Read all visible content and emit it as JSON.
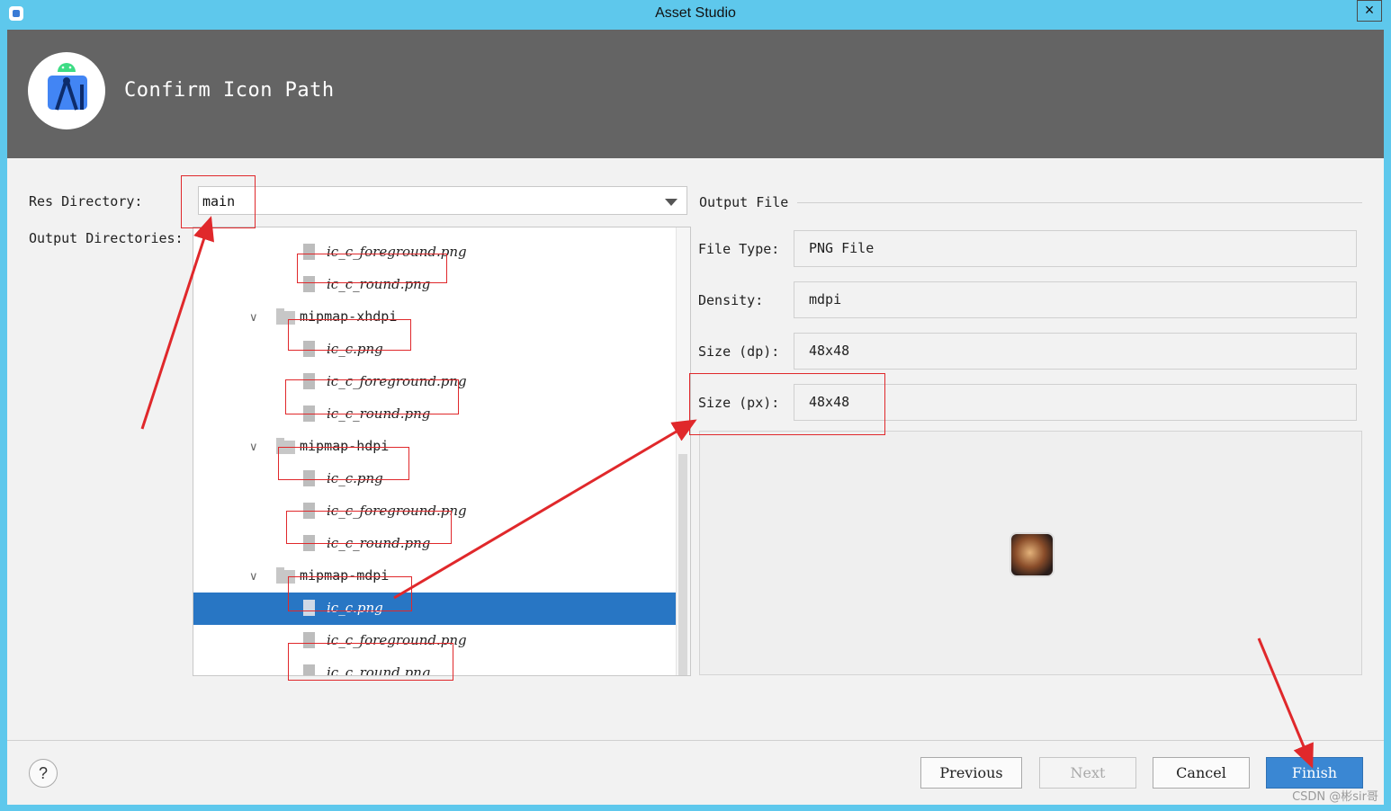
{
  "window": {
    "title": "Asset Studio"
  },
  "header": {
    "title": "Confirm Icon Path"
  },
  "form": {
    "res_directory_label": "Res Directory:",
    "res_directory_value": "main",
    "output_directories_label": "Output Directories:"
  },
  "tree": {
    "rows": [
      {
        "kind": "file",
        "label": "ic_c_foreground.png"
      },
      {
        "kind": "file",
        "label": "ic_c_round.png"
      },
      {
        "kind": "folder",
        "label": "mipmap-xhdpi"
      },
      {
        "kind": "file",
        "label": "ic_c.png"
      },
      {
        "kind": "file",
        "label": "ic_c_foreground.png"
      },
      {
        "kind": "file",
        "label": "ic_c_round.png"
      },
      {
        "kind": "folder",
        "label": "mipmap-hdpi"
      },
      {
        "kind": "file",
        "label": "ic_c.png"
      },
      {
        "kind": "file",
        "label": "ic_c_foreground.png"
      },
      {
        "kind": "file",
        "label": "ic_c_round.png"
      },
      {
        "kind": "folder",
        "label": "mipmap-mdpi"
      },
      {
        "kind": "file",
        "label": "ic_c.png",
        "selected": true
      },
      {
        "kind": "file",
        "label": "ic_c_foreground.png"
      },
      {
        "kind": "file",
        "label": "ic_c_round.png"
      }
    ]
  },
  "output": {
    "title": "Output File",
    "fields": [
      {
        "label": "File Type:",
        "value": "PNG File"
      },
      {
        "label": "Density:",
        "value": "mdpi"
      },
      {
        "label": "Size (dp):",
        "value": "48x48"
      },
      {
        "label": "Size (px):",
        "value": "48x48"
      }
    ]
  },
  "buttons": {
    "help": "?",
    "previous": "Previous",
    "next": "Next",
    "cancel": "Cancel",
    "finish": "Finish"
  },
  "colors": {
    "titlebar": "#5ec8ec",
    "header": "#646464",
    "selection": "#2876c4",
    "primary_button": "#3a87d3",
    "annotation": "#e0282b"
  },
  "watermark": "CSDN @彬sir哥"
}
